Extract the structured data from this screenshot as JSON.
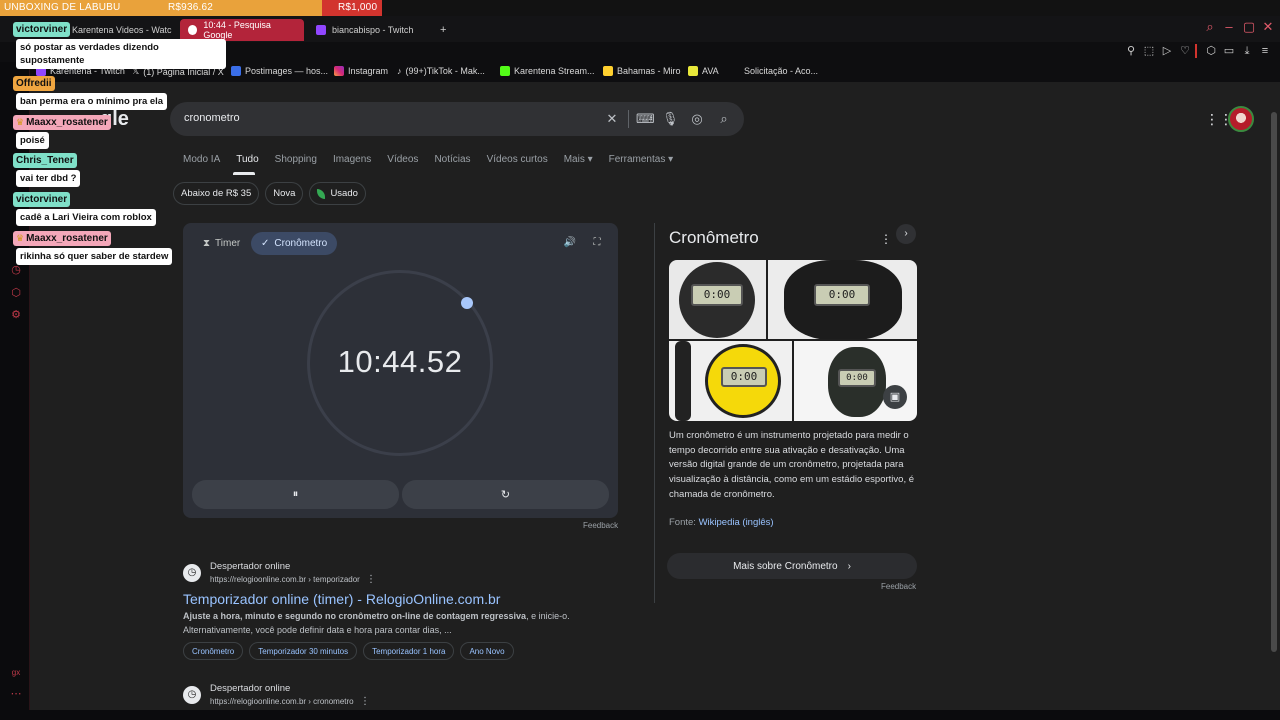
{
  "overlay": {
    "title": "UNBOXING DE LABUBU",
    "current": "R$936.62",
    "goal": "R$1,000",
    "progress_fraction": 0.94
  },
  "tabs": [
    {
      "label": "Karentena Videos - Watc",
      "active": false
    },
    {
      "label": "10:44 - Pesquisa Google",
      "active": true
    },
    {
      "label": "biancabispo - Twitch",
      "active": false
    },
    {
      "label": "+",
      "active": false
    }
  ],
  "bookmarks": [
    {
      "label": "Karentena - Twitch"
    },
    {
      "label": "(1) Página Inicial / X"
    },
    {
      "label": "Postimages — hos..."
    },
    {
      "label": "Instagram"
    },
    {
      "label": "(99+)TikTok - Mak..."
    },
    {
      "label": "Karentena Stream..."
    },
    {
      "label": "Bahamas - Miro"
    },
    {
      "label": "AVA"
    },
    {
      "label": "Solicitação - Aco..."
    }
  ],
  "search": {
    "logo_fragment": "gle",
    "query": "cronometro"
  },
  "nav_tabs": [
    "Modo IA",
    "Tudo",
    "Shopping",
    "Imagens",
    "Vídeos",
    "Notícias",
    "Vídeos curtos",
    "Mais ▾",
    "Ferramentas ▾"
  ],
  "filter_chips": [
    "Abaixo de R$ 35",
    "Nova",
    "Usado"
  ],
  "stopwatch": {
    "timer_label": "Timer",
    "stopwatch_label": "Cronômetro",
    "time": "10:44.52",
    "pause_icon": "⏸",
    "reset_icon": "↻",
    "feedback": "Feedback"
  },
  "results": [
    {
      "site": "Despertador online",
      "url": "https://relogioonline.com.br › temporizador",
      "title": "Temporizador online (timer) - RelogioOnline.com.br",
      "snippet_bold": "Ajuste a hora, minuto e segundo no cronômetro on-line de contagem regressiva",
      "snippet_rest": ", e inicie-o. Alternativamente, você pode definir data e hora para contar dias, ...",
      "chips": [
        "Cronômetro",
        "Temporizador 30 minutos",
        "Temporizador 1 hora",
        "Ano Novo"
      ]
    },
    {
      "site": "Despertador online",
      "url": "https://relogioonline.com.br › cronometro"
    }
  ],
  "knowledge_panel": {
    "title": "Cronômetro",
    "description": "Um cronômetro é um instrumento projetado para medir o tempo decorrido entre sua ativação e desativação. Uma versão digital grande de um cronômetro, projetada para visualização à distância, como em um estádio esportivo, é chamada de cronômetro.",
    "source_label": "Fonte:",
    "source_link": "Wikipedia (inglês)",
    "more_label": "Mais sobre Cronômetro",
    "feedback": "Feedback",
    "lcd_text": "0:00"
  },
  "chat": [
    {
      "user": "victorviner",
      "color": "#7fe0c8",
      "message": "só postar as verdades dizendo supostamente",
      "crown": false
    },
    {
      "user": "Offredii",
      "color": "#f0a640",
      "message": "ban perma era o mínimo pra ela",
      "crown": false
    },
    {
      "user": "Maaxx_rosatener",
      "color": "#f4a7b9",
      "message": "poisé",
      "crown": true
    },
    {
      "user": "Chris_Tener",
      "color": "#7fe0c8",
      "message": "vai ter dbd ?",
      "crown": false
    },
    {
      "user": "victorviner",
      "color": "#7fe0c8",
      "message": "cadê a Lari Vieira com roblox",
      "crown": false
    },
    {
      "user": "Maaxx_rosatener",
      "color": "#f4a7b9",
      "message": "rikinha só quer saber de stardew",
      "crown": true
    }
  ],
  "rail_label": "gx"
}
